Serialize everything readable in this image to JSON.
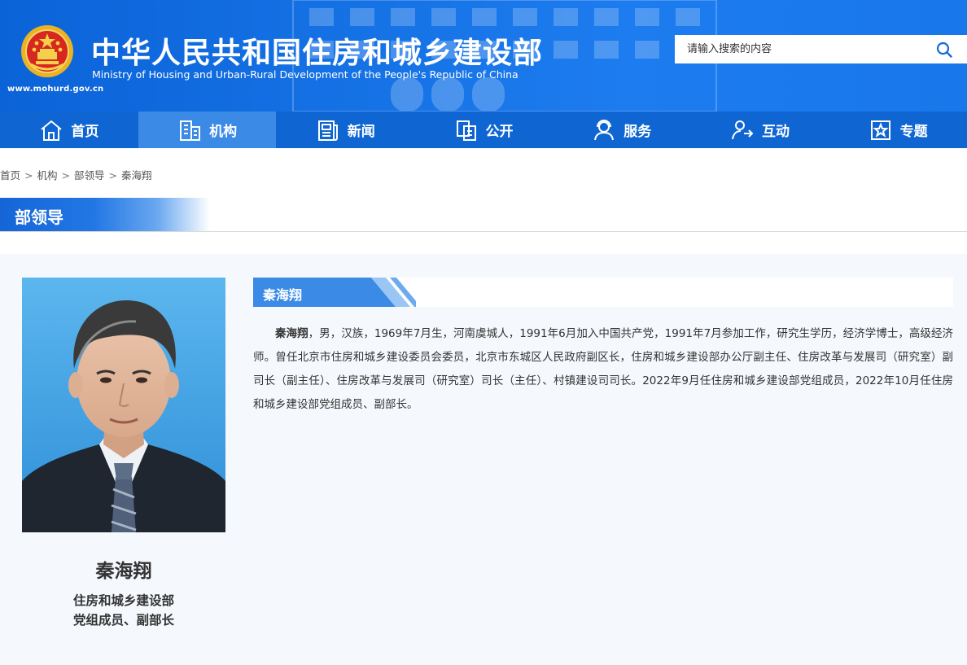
{
  "header": {
    "site_title": "中华人民共和国住房和城乡建设部",
    "site_subtitle": "Ministry of Housing and Urban-Rural Development of the People's Republic of China",
    "site_url": "www.mohurd.gov.cn",
    "emblem_icon": "national-emblem-icon",
    "colors": {
      "brand_blue": "#0f66d3",
      "active_tab": "#3a8ae6"
    }
  },
  "search": {
    "placeholder": "请输入搜索的内容",
    "button_icon": "search-icon"
  },
  "nav": {
    "items": [
      {
        "label": "首页",
        "icon": "home-icon"
      },
      {
        "label": "机构",
        "icon": "building-icon",
        "active": true
      },
      {
        "label": "新闻",
        "icon": "news-icon"
      },
      {
        "label": "公开",
        "icon": "documents-icon"
      },
      {
        "label": "服务",
        "icon": "service-icon"
      },
      {
        "label": "互动",
        "icon": "interaction-icon"
      },
      {
        "label": "专题",
        "icon": "star-icon"
      }
    ]
  },
  "breadcrumb": {
    "items": [
      "首页",
      "机构",
      "部领导",
      "秦海翔"
    ],
    "separator": ">"
  },
  "section": {
    "title": "部领导"
  },
  "leader": {
    "name": "秦海翔",
    "title_line1": "住房和城乡建设部",
    "title_line2": "党组成员、副部长",
    "bio_name": "秦海翔",
    "bio_body": "，男，汉族，1969年7月生，河南虞城人，1991年6月加入中国共产党，1991年7月参加工作，研究生学历，经济学博士，高级经济师。曾任北京市住房和城乡建设委员会委员，北京市东城区人民政府副区长，住房和城乡建设部办公厅副主任、住房改革与发展司（研究室）副司长（副主任）、住房改革与发展司（研究室）司长（主任）、村镇建设司司长。2022年9月任住房和城乡建设部党组成员，2022年10月任住房和城乡建设部党组成员、副部长。"
  }
}
